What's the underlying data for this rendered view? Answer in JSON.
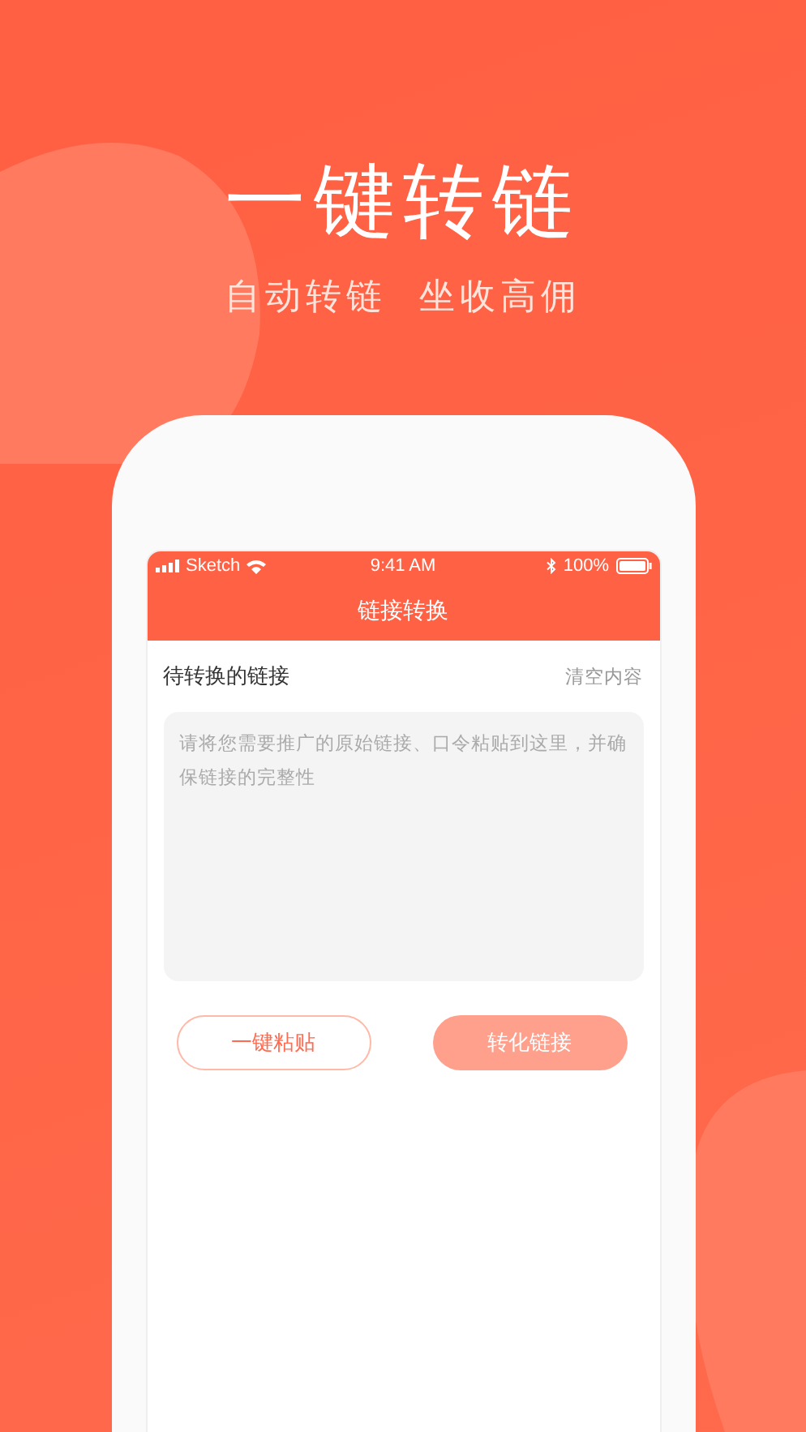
{
  "headline": "一键转链",
  "subtitle": "自动转链  坐收高佣",
  "status_bar": {
    "carrier": "Sketch",
    "time": "9:41 AM",
    "battery": "100%"
  },
  "nav_title": "链接转换",
  "section": {
    "title": "待转换的链接",
    "action": "清空内容"
  },
  "input": {
    "placeholder": "请将您需要推广的原始链接、口令粘贴到这里，并确保链接的完整性"
  },
  "buttons": [
    {
      "label": "一键粘贴",
      "kind": "outline"
    },
    {
      "label": "转化链接",
      "kind": "filled"
    }
  ]
}
